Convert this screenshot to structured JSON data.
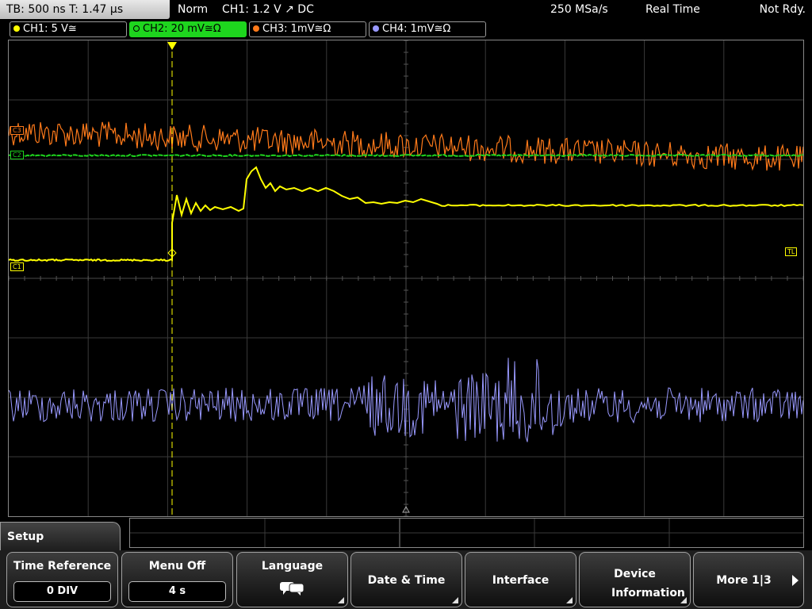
{
  "topbar": {
    "tb_label": "TB: 500 ns   T: 1.47 μs",
    "trigger_mode": "Norm",
    "trigger_info": "CH1: 1.2 V ↗ DC",
    "sample_rate": "250 MSa/s",
    "acq_mode": "Real Time",
    "status": "Not Rdy."
  },
  "channels": [
    {
      "label": "CH1: 5 V≅",
      "color": "#ffff00"
    },
    {
      "label": "CH2: 20 mV≅Ω",
      "color": "#1ed51e"
    },
    {
      "label": "CH3: 1mV≅Ω",
      "color": "#ff7a1a"
    },
    {
      "label": "CH4: 1mV≅Ω",
      "color": "#9999ff"
    }
  ],
  "markers": {
    "c3": "C3",
    "c2": "C2",
    "c1": "C1",
    "tl": "TL",
    "trigger_pos": "T"
  },
  "menu": {
    "title": "Setup",
    "keys": [
      {
        "label": "Time Reference",
        "value": "0 DIV"
      },
      {
        "label": "Menu Off",
        "value": "4 s"
      },
      {
        "label": "Language",
        "icon": "speech-bubbles-icon"
      },
      {
        "label": "Date & Time"
      },
      {
        "label": "Interface"
      },
      {
        "label": "Device Information"
      },
      {
        "label": "More 1|3"
      }
    ]
  },
  "colors": {
    "ch1": "#ffff00",
    "ch2": "#1ed51e",
    "ch3": "#ff7a1a",
    "ch4": "#9999ff",
    "grid": "#3a3a3a"
  }
}
